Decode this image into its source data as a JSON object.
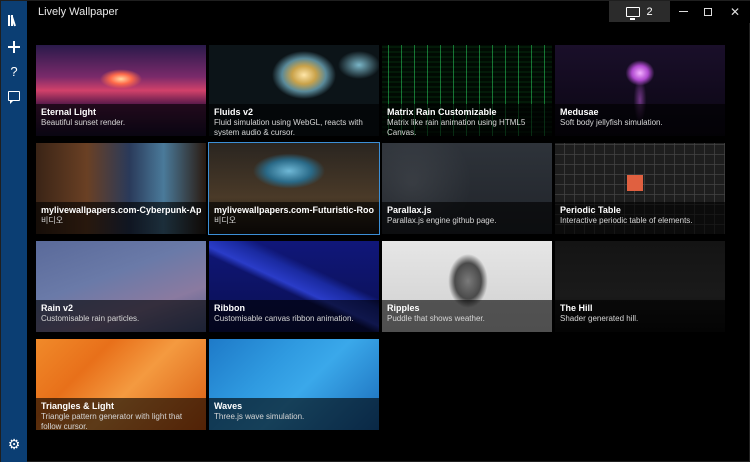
{
  "app": {
    "title": "Lively Wallpaper"
  },
  "titlebar": {
    "monitor_count": "2",
    "close_label": "✕"
  },
  "sidebar": {
    "items": [
      {
        "name": "library-icon"
      },
      {
        "name": "add-wallpaper-icon"
      },
      {
        "name": "help-icon",
        "glyph": "?"
      },
      {
        "name": "feedback-icon"
      },
      {
        "name": "settings-icon",
        "glyph": "⚙"
      }
    ]
  },
  "wallpapers": [
    {
      "title": "Eternal Light",
      "description": "Beautiful sunset render."
    },
    {
      "title": "Fluids v2",
      "description": "Fluid simulation using WebGL, reacts with system audio & cursor."
    },
    {
      "title": "Matrix Rain Customizable",
      "description": "Matrix like rain animation using HTML5 Canvas."
    },
    {
      "title": "Medusae",
      "description": "Soft body jellyfish simulation."
    },
    {
      "title": "mylivewallpapers.com-Cyberpunk-Apartr",
      "description": "비디오"
    },
    {
      "title": "mylivewallpapers.com-Futuristic-Room-A",
      "description": "비디오"
    },
    {
      "title": "Parallax.js",
      "description": "Parallax.js engine github page."
    },
    {
      "title": "Periodic Table",
      "description": "Interactive periodic table of elements."
    },
    {
      "title": "Rain v2",
      "description": "Customisable rain particles."
    },
    {
      "title": "Ribbon",
      "description": "Customisable canvas ribbon animation."
    },
    {
      "title": "Ripples",
      "description": "Puddle that shows weather."
    },
    {
      "title": "The Hill",
      "description": "Shader generated hill."
    },
    {
      "title": "Triangles & Light",
      "description": "Triangle pattern generator with light that follow cursor."
    },
    {
      "title": "Waves",
      "description": "Three.js wave simulation."
    }
  ],
  "colors": {
    "sidebar": "#0b3e73",
    "selected_border": "#3c8fd6"
  }
}
